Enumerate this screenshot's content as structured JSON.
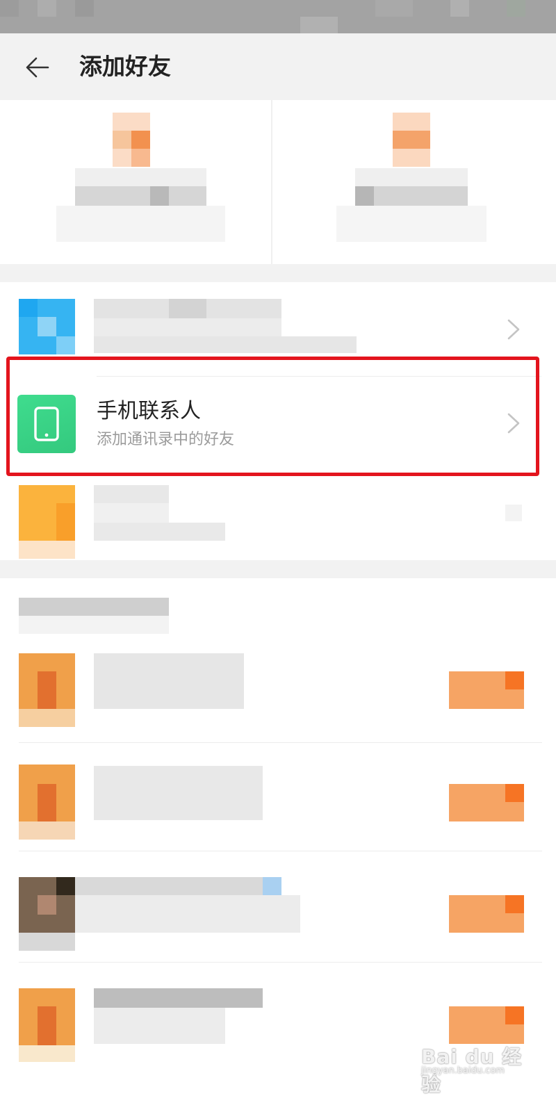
{
  "header": {
    "title": "添加好友"
  },
  "contacts_item": {
    "title": "手机联系人",
    "subtitle": "添加通讯录中的好友"
  },
  "watermark": {
    "brand": "Bai du 经验",
    "url": "jingyan.baidu.com"
  },
  "colors": {
    "highlight": "#e3141d",
    "phone_tile": "#3fdc8e",
    "header_bg": "#f2f2f2"
  }
}
